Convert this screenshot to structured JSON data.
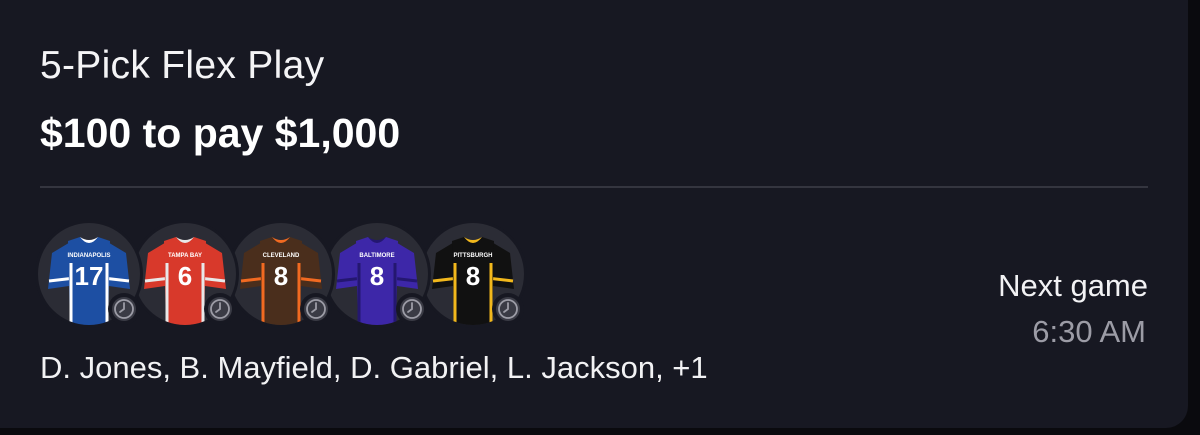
{
  "entry": {
    "title": "5-Pick Flex Play",
    "payout": "$100 to pay $1,000"
  },
  "picks": [
    {
      "team": "INDIANAPOLIS",
      "number": "17",
      "jersey_color": "#1d4fa3",
      "trim_color": "#ffffff",
      "text_color": "#ffffff",
      "status_icon": "clock-icon"
    },
    {
      "team": "TAMPA BAY",
      "number": "6",
      "jersey_color": "#d8392b",
      "trim_color": "#e8e8e8",
      "text_color": "#ffffff",
      "status_icon": "clock-icon"
    },
    {
      "team": "CLEVELAND",
      "number": "8",
      "jersey_color": "#4a2e1c",
      "trim_color": "#f26a21",
      "text_color": "#ffffff",
      "status_icon": "clock-icon"
    },
    {
      "team": "BALTIMORE",
      "number": "8",
      "jersey_color": "#3d27a8",
      "trim_color": "#241770",
      "text_color": "#ffffff",
      "status_icon": "clock-icon"
    },
    {
      "team": "PITTSBURGH",
      "number": "8",
      "jersey_color": "#111111",
      "trim_color": "#f2b81c",
      "text_color": "#ffffff",
      "status_icon": "clock-icon"
    }
  ],
  "players_summary": "D. Jones, B. Mayfield, D. Gabriel, L. Jackson, +1",
  "next_game": {
    "label": "Next game",
    "time": "6:30 AM"
  },
  "colors": {
    "card_background": "#171822",
    "page_background": "#0a0a0e",
    "divider": "#34353f",
    "muted_text": "#9c9ca6"
  }
}
